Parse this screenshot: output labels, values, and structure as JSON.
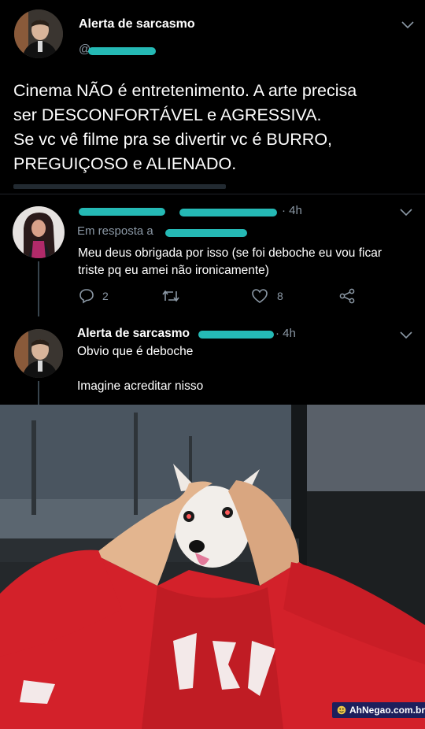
{
  "tweet": {
    "author_name": "Alerta de sarcasmo",
    "handle": "@",
    "text_lines": [
      "Cinema NÃO é entretenimento. A arte precisa",
      "ser DESCONFORTÁVEL e AGRESSIVA.",
      "Se vc vê filme pra se divertir vc é BURRO,",
      "PREGUIÇOSO e ALIENADO."
    ]
  },
  "reply1": {
    "time": "· 4h",
    "reply_prefix": "Em resposta a",
    "text_lines": [
      "Meu deus obrigada por isso (se foi deboche eu vou ficar",
      "triste pq eu amei não ironicamente)"
    ],
    "reply_count": "2",
    "like_count": "8"
  },
  "reply2": {
    "author_name": "Alerta de sarcasmo",
    "time": "· 4h",
    "line1": "Obvio que é deboche",
    "line2": "Imagine acreditar nisso"
  },
  "watermark": {
    "text": "AhNegao.com.br"
  },
  "colors": {
    "background": "#000000",
    "text": "#e7e9ea",
    "muted": "#8b98a5",
    "scribble": "#27c3bf",
    "hoodie": "#d3212a"
  }
}
